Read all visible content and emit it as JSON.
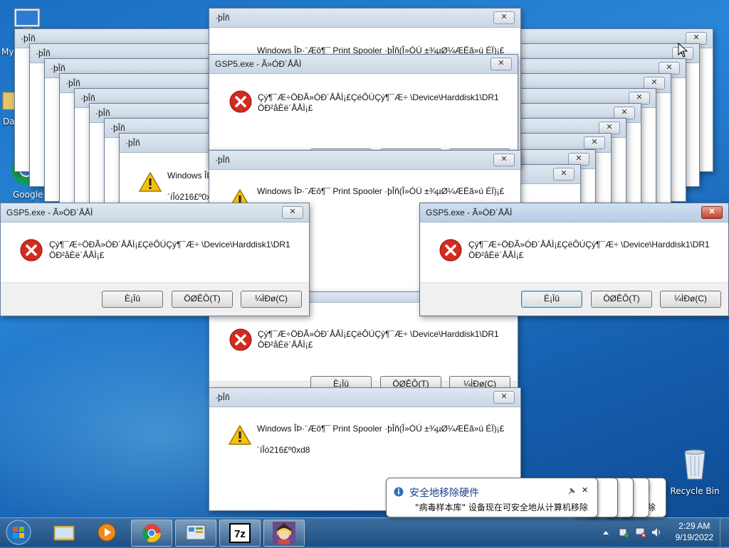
{
  "desktop": {
    "icons": [
      {
        "label": "My"
      },
      {
        "label": "Dat"
      },
      {
        "label": "Google"
      },
      {
        "label": "Recycle Bin"
      }
    ]
  },
  "dialogs": {
    "generic_title": "·þÎñ",
    "gsp_title": "GSP5.exe - Ã»ÓÐ´ÅÅÌ",
    "spooler_msg": "Windows ÎÞ·¨Æô¶¯ Print Spooler ·þÎñ(Î»ÓÚ ±¾µØ¼ÆËã»ú ÉÏ)¡£",
    "spooler_msg_trunc": "Windows ÎÞ",
    "err_code": "´íÎó216£º0xd8",
    "err_code_trunc": "´íÎó216£º0x",
    "disk_msg_1": "Çý¶¯Æ÷ÖÐÃ»ÓÐ´ÅÅÌ¡£ÇëÔÚÇý¶¯Æ÷ \\Device\\Harddisk1\\DR1",
    "disk_msg_2": "ÖÐ²åÈë´ÅÅÌ¡£",
    "btn_cancel": "È¡Ïû",
    "btn_retry": "ÖØÊÔ(T)",
    "btn_continue": "¼ÌÐø(C)",
    "close": "✕"
  },
  "balloon": {
    "title": "安全地移除硬件",
    "message": "\"病毒样本库\" 设备现在可安全地从计算机移除",
    "stacked_tail": "除"
  },
  "taskbar": {
    "time": "2:29 AM",
    "date": "9/19/2022",
    "items": [
      "start",
      "explorer",
      "media-player",
      "chrome",
      "control-panel",
      "7zip",
      "app-character"
    ]
  },
  "colors": {
    "error_red": "#d42a20",
    "warning_yellow": "#f4c20d",
    "desktop_blue": "#1a6fc2"
  }
}
